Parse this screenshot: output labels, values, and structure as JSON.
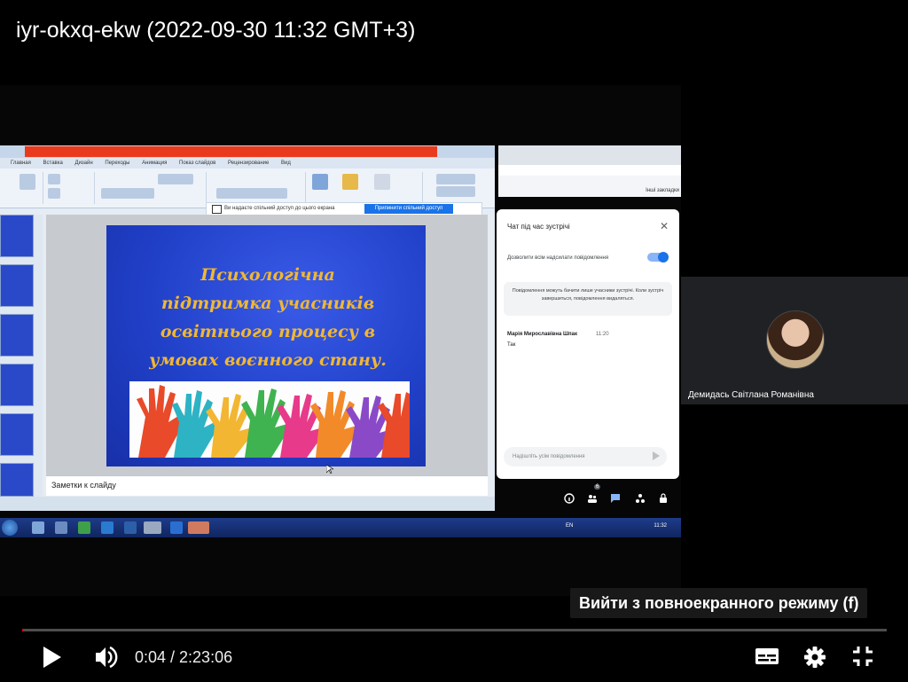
{
  "video": {
    "title": "iyr-okxq-ekw (2022-09-30 11:32 GMT+3)"
  },
  "presentation": {
    "slide_title_lines": [
      "Психологічна",
      "підтримка учасників",
      "освітнього процесу в",
      "умовах воєнного стану."
    ],
    "notes_placeholder": "Заметки к слайду",
    "share_bar_text": "Ви надаєте спільний доступ до цього екрана",
    "share_bar_button": "Припинити спільний доступ",
    "ribbon_tabs": [
      "Главная",
      "Вставка",
      "Дизайн",
      "Переходы",
      "Анимация",
      "Показ слайдов",
      "Рецензирование",
      "Вид"
    ]
  },
  "taskbar": {
    "lang": "EN",
    "time": "11:32"
  },
  "browser": {
    "bookmark_text": "Інші закладки"
  },
  "chat": {
    "title": "Чат під час зустрічі",
    "allow_label": "Дозволити всім надсилати повідомлення",
    "allow_enabled": true,
    "info_text": "Повідомлення можуть бачити лише учасники зустрічі. Коли зустріч завершиться, повідомлення видаляться.",
    "sender": "Марія Мирославівна Шпак",
    "sent_time": "11:20",
    "message": "Так",
    "input_placeholder": "Надішліть усім повідомлення",
    "participants_badge": "6"
  },
  "participant": {
    "name": "Демидась Світлана Романівна"
  },
  "player": {
    "tooltip": "Вийти з повноекранного режиму (f)",
    "current_time": "0:04",
    "duration": "2:23:06",
    "time_display": "0:04 / 2:23:06",
    "progress_fraction": 0.0005,
    "accent_color": "#ff0000"
  },
  "icons": {
    "play": "play-icon",
    "volume": "volume-icon",
    "captions": "captions-icon",
    "settings": "gear-icon",
    "exit_fullscreen": "exit-fullscreen-icon"
  }
}
